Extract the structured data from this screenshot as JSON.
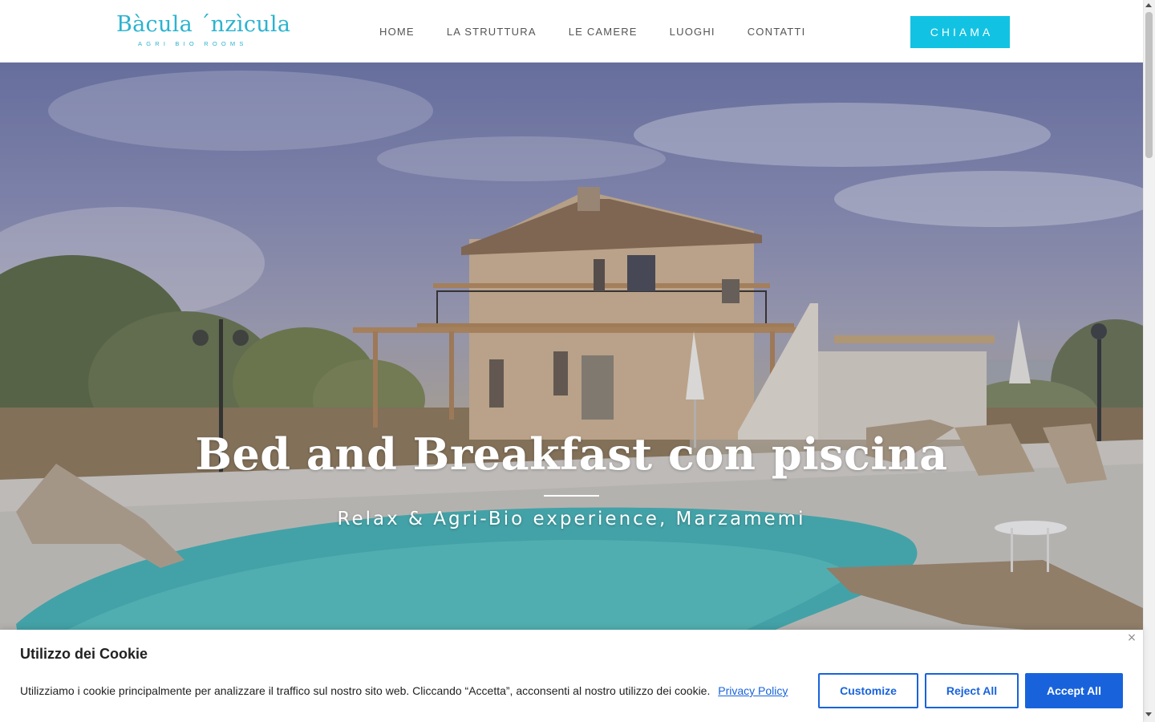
{
  "header": {
    "logo_title": "Bàcula ´nzìcula",
    "logo_subtitle": "AGRI BIO ROOMS",
    "nav": [
      {
        "label": "HOME"
      },
      {
        "label": "LA STRUTTURA"
      },
      {
        "label": "LE CAMERE"
      },
      {
        "label": "LUOGHI"
      },
      {
        "label": "CONTATTI"
      }
    ],
    "call_label": "CHIAMA"
  },
  "hero": {
    "title": "Bed and Breakfast con piscina",
    "subtitle": "Relax & Agri-Bio experience, Marzamemi"
  },
  "cookie_banner": {
    "title": "Utilizzo dei Cookie",
    "text": "Utilizziamo i cookie principalmente per analizzare il traffico sul nostro sito web. Cliccando “Accetta”, acconsenti al nostro utilizzo dei cookie.",
    "privacy_link": "Privacy Policy",
    "customize_label": "Customize",
    "reject_label": "Reject All",
    "accept_label": "Accept All",
    "close_symbol": "×"
  },
  "colors": {
    "brand": "#2bb3cf",
    "call_button": "#12c2e3",
    "cookie_accent": "#1863dc"
  }
}
